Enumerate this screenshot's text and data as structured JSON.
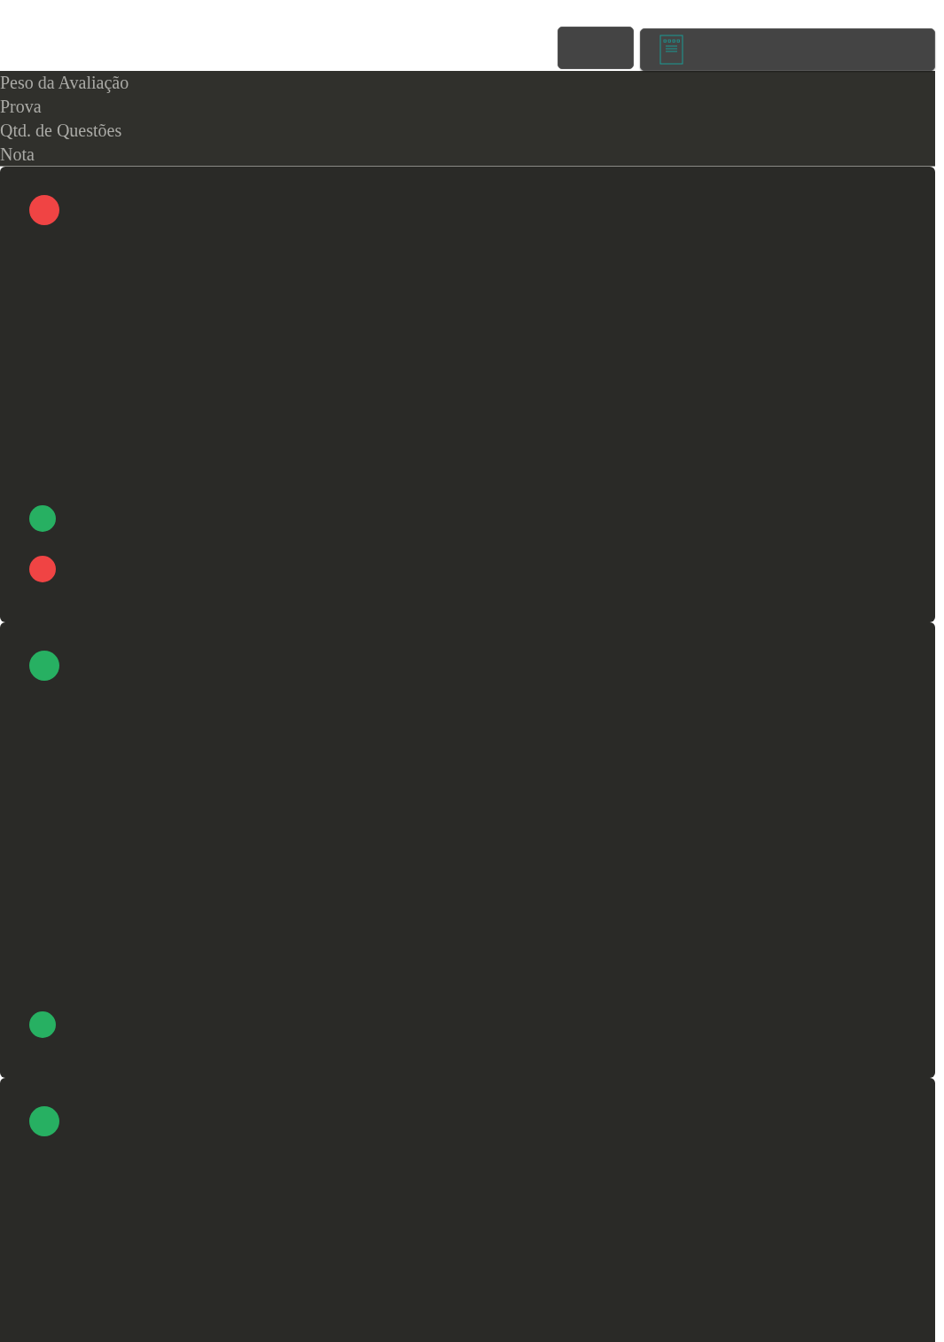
{
  "header": {
    "labels": [
      "Peso da Avaliação",
      "Prova",
      "Qtd. de Questões",
      "Nota"
    ]
  },
  "cards": [
    {
      "color": "#f04444",
      "markers": [
        {
          "color": "#27b062"
        },
        {
          "color": "#f04444"
        }
      ]
    },
    {
      "color": "#27b062",
      "markers": [
        {
          "color": "#27b062"
        }
      ]
    },
    {
      "color": "#27b062"
    }
  ]
}
